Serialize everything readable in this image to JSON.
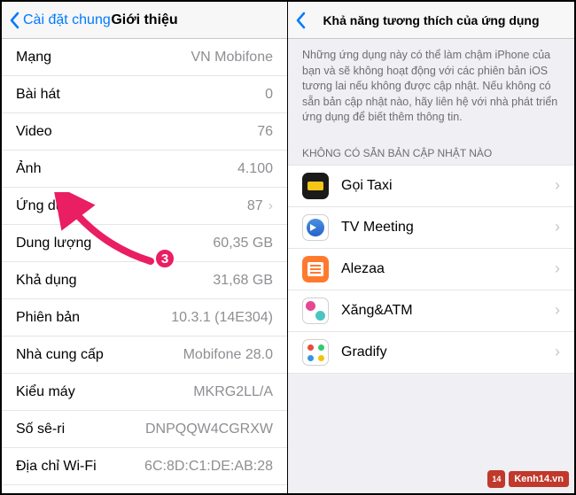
{
  "left": {
    "back": "Cài đặt chung",
    "title": "Giới thiệu",
    "rows": [
      {
        "label": "Mạng",
        "value": "VN Mobifone",
        "chev": false
      },
      {
        "label": "Bài hát",
        "value": "0",
        "chev": false
      },
      {
        "label": "Video",
        "value": "76",
        "chev": false
      },
      {
        "label": "Ảnh",
        "value": "4.100",
        "chev": false
      },
      {
        "label": "Ứng dụng",
        "value": "87",
        "chev": true
      },
      {
        "label": "Dung lượng",
        "value": "60,35 GB",
        "chev": false
      },
      {
        "label": "Khả dụng",
        "value": "31,68 GB",
        "chev": false
      },
      {
        "label": "Phiên bản",
        "value": "10.3.1 (14E304)",
        "chev": false
      },
      {
        "label": "Nhà cung cấp",
        "value": "Mobifone 28.0",
        "chev": false
      },
      {
        "label": "Kiểu máy",
        "value": "MKRG2LL/A",
        "chev": false
      },
      {
        "label": "Số sê-ri",
        "value": "DNPQQW4CGRXW",
        "chev": false
      },
      {
        "label": "Địa chỉ Wi-Fi",
        "value": "6C:8D:C1:DE:AB:28",
        "chev": false
      }
    ]
  },
  "right": {
    "title": "Khả năng tương thích của ứng dụng",
    "footer": "Những ứng dụng này có thể làm chậm iPhone của bạn và sẽ không hoạt động với các phiên bản iOS tương lai nếu không được cập nhật. Nếu không có sẵn bản cập nhật nào, hãy liên hệ với nhà phát triển ứng dụng để biết thêm thông tin.",
    "section": "KHÔNG CÓ SẴN BẢN CẬP NHẬT NÀO",
    "apps": [
      {
        "name": "Gọi Taxi",
        "icon": "taxi"
      },
      {
        "name": "TV Meeting",
        "icon": "tv"
      },
      {
        "name": "Alezaa",
        "icon": "alezaa"
      },
      {
        "name": "Xăng&ATM",
        "icon": "xang"
      },
      {
        "name": "Gradify",
        "icon": "gradify"
      }
    ]
  },
  "annotation": {
    "step": "3"
  },
  "watermark": {
    "badge": "14",
    "text": "Kenh14.vn"
  }
}
